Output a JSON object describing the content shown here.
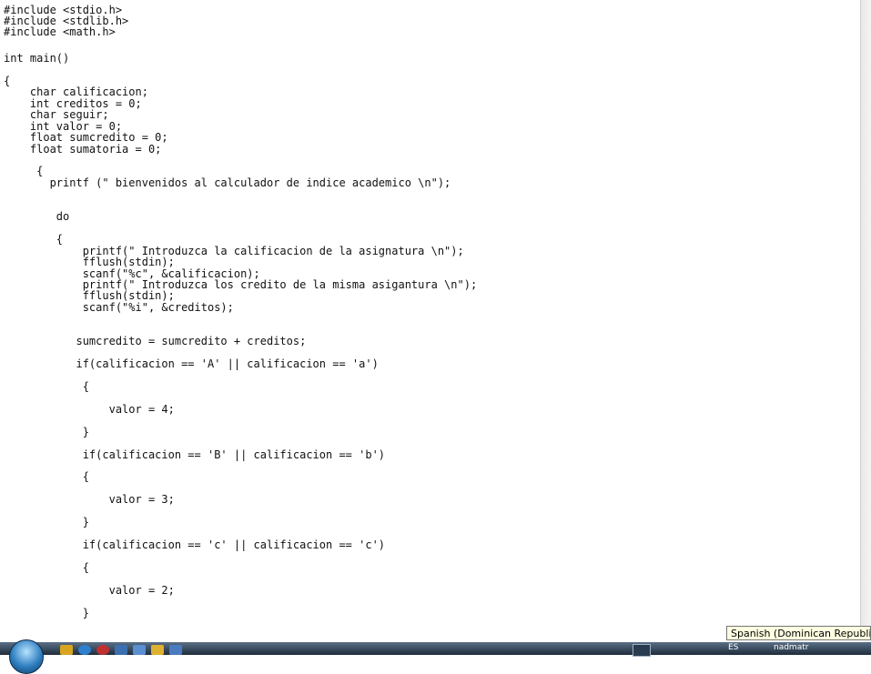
{
  "editor": {
    "lines": [
      "#include <stdio.h>",
      "#include <stdlib.h>",
      "#include <math.h>",
      "int main()",
      "{",
      "    char calificacion;",
      "    int creditos = 0;",
      "    char seguir;",
      "    int valor = 0;",
      "    float sumcredito = 0;",
      "    float sumatoria = 0;",
      "     {",
      "       printf (\" bienvenidos al calculador de indice academico \\n\");",
      "        do",
      "        {",
      "            printf(\" Introduzca la calificacion de la asignatura \\n\");",
      "            fflush(stdin);",
      "            scanf(\"%c\", &calificacion);",
      "            printf(\" Introduzca los credito de la misma asigantura \\n\");",
      "            fflush(stdin);",
      "            scanf(\"%i\", &creditos);",
      "           sumcredito = sumcredito + creditos;",
      "           if(calificacion == 'A' || calificacion == 'a')",
      "            {",
      "                valor = 4;",
      "            }",
      "            if(calificacion == 'B' || calificacion == 'b')",
      "            {",
      "                valor = 3;",
      "            }",
      "            if(calificacion == 'c' || calificacion == 'c')",
      "            {",
      "                valor = 2;",
      "            }"
    ]
  },
  "taskbar": {
    "lang_code": "ES",
    "user_label": "nadmatr"
  },
  "tooltip": {
    "text": "Spanish (Dominican Republic)"
  },
  "colors": {
    "code_text": "#111111",
    "taskbar": "#1f2d3c",
    "tooltip_bg": "#ffffe1"
  }
}
